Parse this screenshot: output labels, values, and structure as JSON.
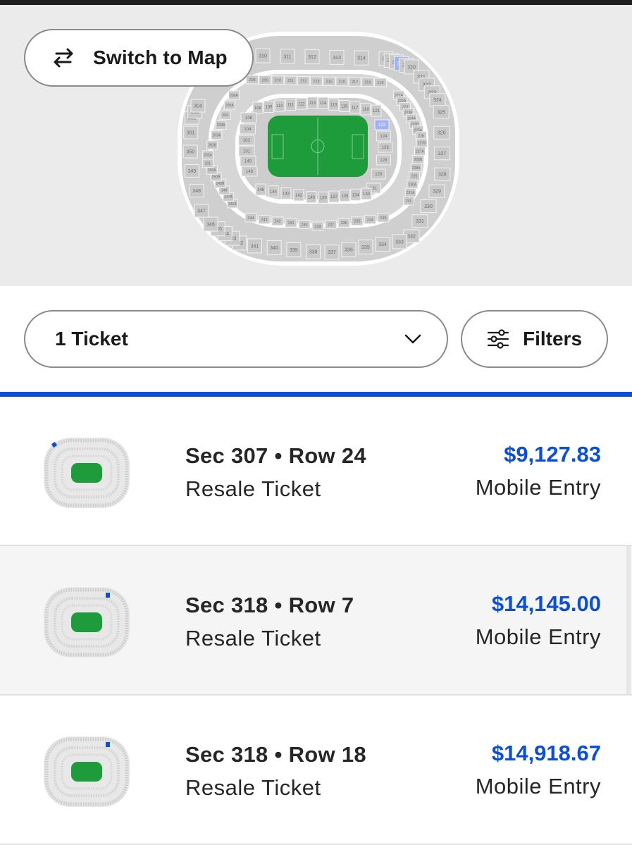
{
  "map": {
    "switch_label": "Switch to Map",
    "highlight_color": "#9fb3f5",
    "field_color": "#1e9b3b",
    "sections_300_top": [
      "310",
      "311",
      "312",
      "313",
      "314",
      "315",
      "316",
      "317",
      "318",
      "319",
      "320"
    ],
    "sections_300_right": [
      "321",
      "322",
      "323",
      "324",
      "325",
      "326",
      "327",
      "328",
      "329",
      "330",
      "331",
      "332"
    ],
    "sections_300_bottom": [
      "333",
      "334",
      "335",
      "336",
      "337",
      "338",
      "339",
      "340",
      "341",
      "342",
      "343",
      "344",
      "345",
      "346"
    ],
    "sections_300_left": [
      "347",
      "348",
      "349",
      "350",
      "301",
      "302",
      "303",
      "304"
    ],
    "sections_100_top": [
      "108",
      "109",
      "110",
      "111",
      "112",
      "113",
      "114",
      "115",
      "116",
      "117",
      "118",
      "121"
    ],
    "sections_100_right": [
      "123",
      "124",
      "126",
      "128",
      "129",
      "131"
    ],
    "sections_100_bottom": [
      "133",
      "134",
      "135",
      "137",
      "139",
      "140",
      "142",
      "143",
      "144",
      "146"
    ],
    "sections_100_left": [
      "148",
      "149",
      "101",
      "103",
      "104",
      "106"
    ],
    "sections_200_top": [
      "208",
      "209",
      "210",
      "211",
      "212",
      "213",
      "215",
      "216",
      "217",
      "218",
      "219"
    ],
    "sections_200_right": [
      "221A",
      "222A",
      "223",
      "224B",
      "224A",
      "225B",
      "225A",
      "226",
      "227B",
      "227A",
      "228B",
      "228A",
      "229",
      "230A",
      "231A",
      "231"
    ],
    "sections_200_bottom": [
      "233",
      "234",
      "235",
      "236",
      "237",
      "239",
      "240",
      "241",
      "242",
      "243",
      "244"
    ],
    "sections_200_left": [
      "246A",
      "247A",
      "248",
      "249B",
      "250B",
      "250A",
      "201",
      "202A",
      "202B",
      "203A",
      "203B",
      "204",
      "205A",
      "206A"
    ],
    "highlighted_sections": [
      "318",
      "123"
    ]
  },
  "controls": {
    "ticket_quantity": "1 Ticket",
    "filters_label": "Filters"
  },
  "accent_color": "#0a4fd6",
  "listings": [
    {
      "seat": "Sec 307 • Row 24",
      "type": "Resale Ticket",
      "price": "$9,127.83",
      "entry": "Mobile Entry",
      "marker": "left"
    },
    {
      "seat": "Sec 318 • Row 7",
      "type": "Resale Ticket",
      "price": "$14,145.00",
      "entry": "Mobile Entry",
      "marker": "right"
    },
    {
      "seat": "Sec 318 • Row 18",
      "type": "Resale Ticket",
      "price": "$14,918.67",
      "entry": "Mobile Entry",
      "marker": "right"
    }
  ]
}
